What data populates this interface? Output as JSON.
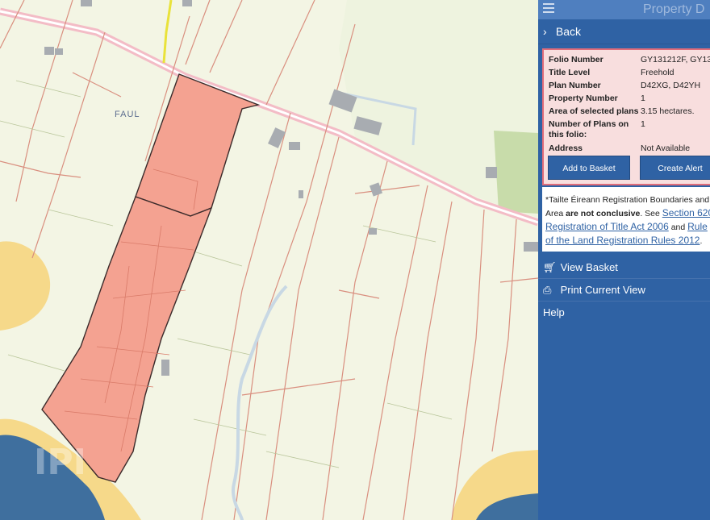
{
  "map": {
    "place_label": "FAUL",
    "watermark": "IPI",
    "colors": {
      "land": "#f3f5e4",
      "parcel": "#f4a291",
      "boundary": "#c97a6a",
      "sea": "#3f6f9e",
      "shore": "#f6d98a",
      "road": "#f7c9d2",
      "forest": "#cfe0b5"
    }
  },
  "panel": {
    "title": "Property D",
    "back_label": "Back",
    "details": [
      {
        "label": "Folio Number",
        "value": "GY131212F, GY13"
      },
      {
        "label": "Title Level",
        "value": "Freehold"
      },
      {
        "label": "Plan Number",
        "value": "D42XG, D42YH"
      },
      {
        "label": "Property Number",
        "value": "1"
      },
      {
        "label": "Area of selected plans",
        "value": "3.15 hectares."
      },
      {
        "label": "Number of Plans on this folio:",
        "value": "1"
      },
      {
        "label": "Address",
        "value": "Not Available"
      }
    ],
    "buttons": {
      "add_basket": "Add to Basket",
      "create_alert": "Create Alert"
    },
    "notice": {
      "line1": "*Tailte Éireann Registration Boundaries and",
      "line2_pre": "Area",
      "line2_bold": "are not conclusive",
      "line2_post": ". See",
      "link1a": "Section 620",
      "link1b": "Registration of Title Act 2006",
      "and_word": "and",
      "link2a": "Rule",
      "link2b": "of the Land Registration Rules 2012",
      "end": "."
    },
    "nav": {
      "view_basket": "View Basket",
      "print_view": "Print Current View",
      "help": "Help"
    }
  }
}
